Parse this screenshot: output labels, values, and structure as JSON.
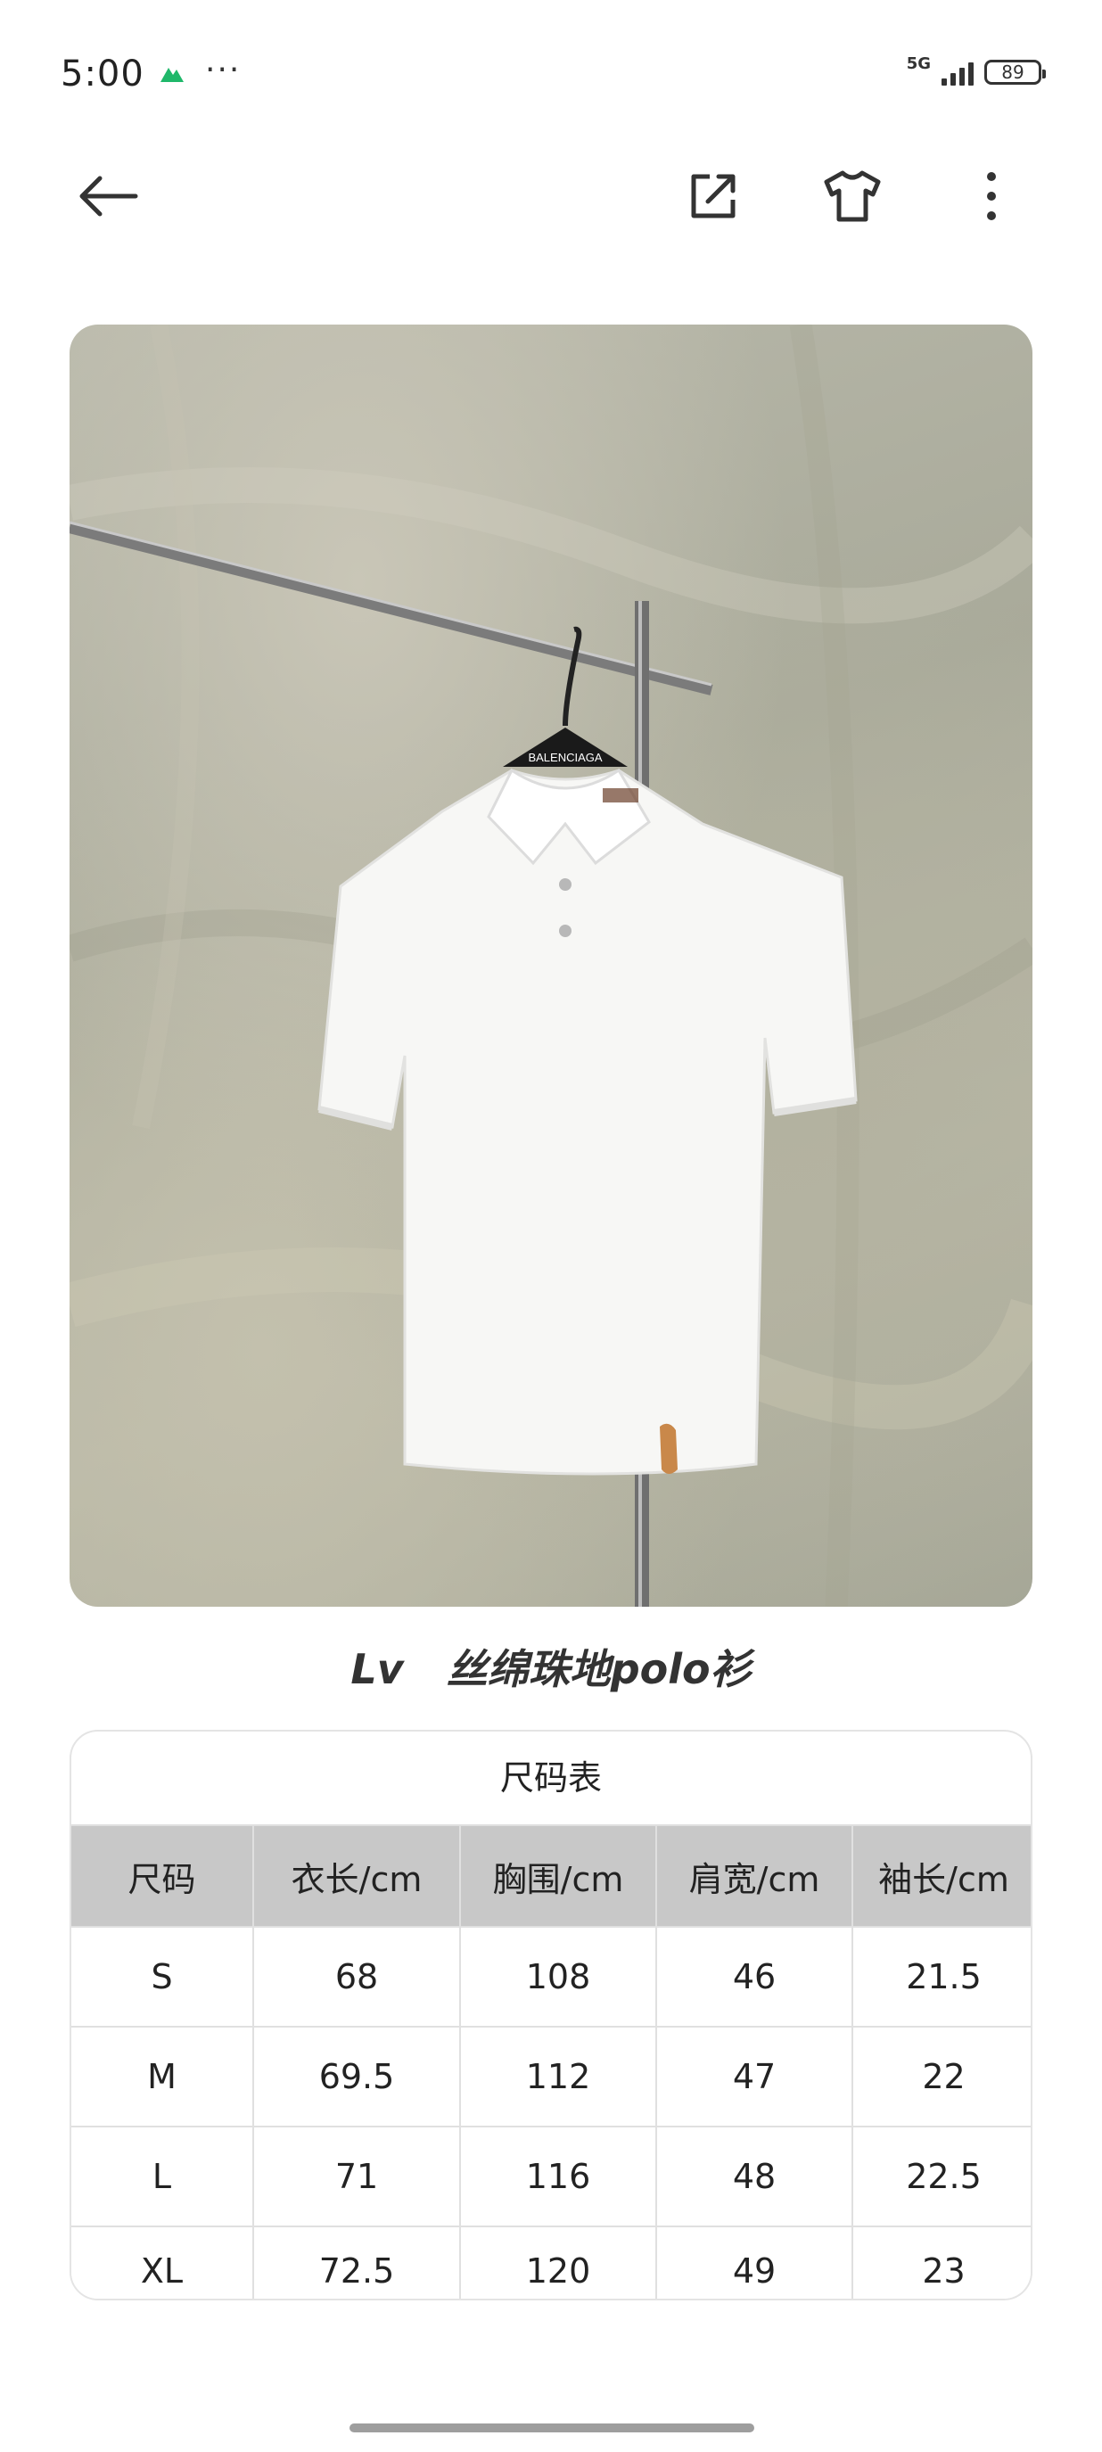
{
  "status_bar": {
    "time": "5:00",
    "dots": "···",
    "network": "5G",
    "battery": "89"
  },
  "toolbar": {
    "icons": [
      "back-arrow-icon",
      "share-icon",
      "shirt-icon",
      "more-vertical-icon"
    ]
  },
  "photo": {
    "hanger_brand": "BALENCIAGA"
  },
  "product": {
    "brand": "Lv",
    "name": "丝绵珠地polo衫"
  },
  "size_table": {
    "caption": "尺码表",
    "headers": [
      "尺码",
      "衣长/cm",
      "胸围/cm",
      "肩宽/cm",
      "袖长/cm"
    ],
    "rows": [
      [
        "S",
        "68",
        "108",
        "46",
        "21.5"
      ],
      [
        "M",
        "69.5",
        "112",
        "47",
        "22"
      ],
      [
        "L",
        "71",
        "116",
        "48",
        "22.5"
      ],
      [
        "XL",
        "72.5",
        "120",
        "49",
        "23"
      ]
    ]
  },
  "colors": {
    "table_header_bg": "#c8c8c8",
    "border": "#e0e0e0",
    "text": "#222222"
  }
}
